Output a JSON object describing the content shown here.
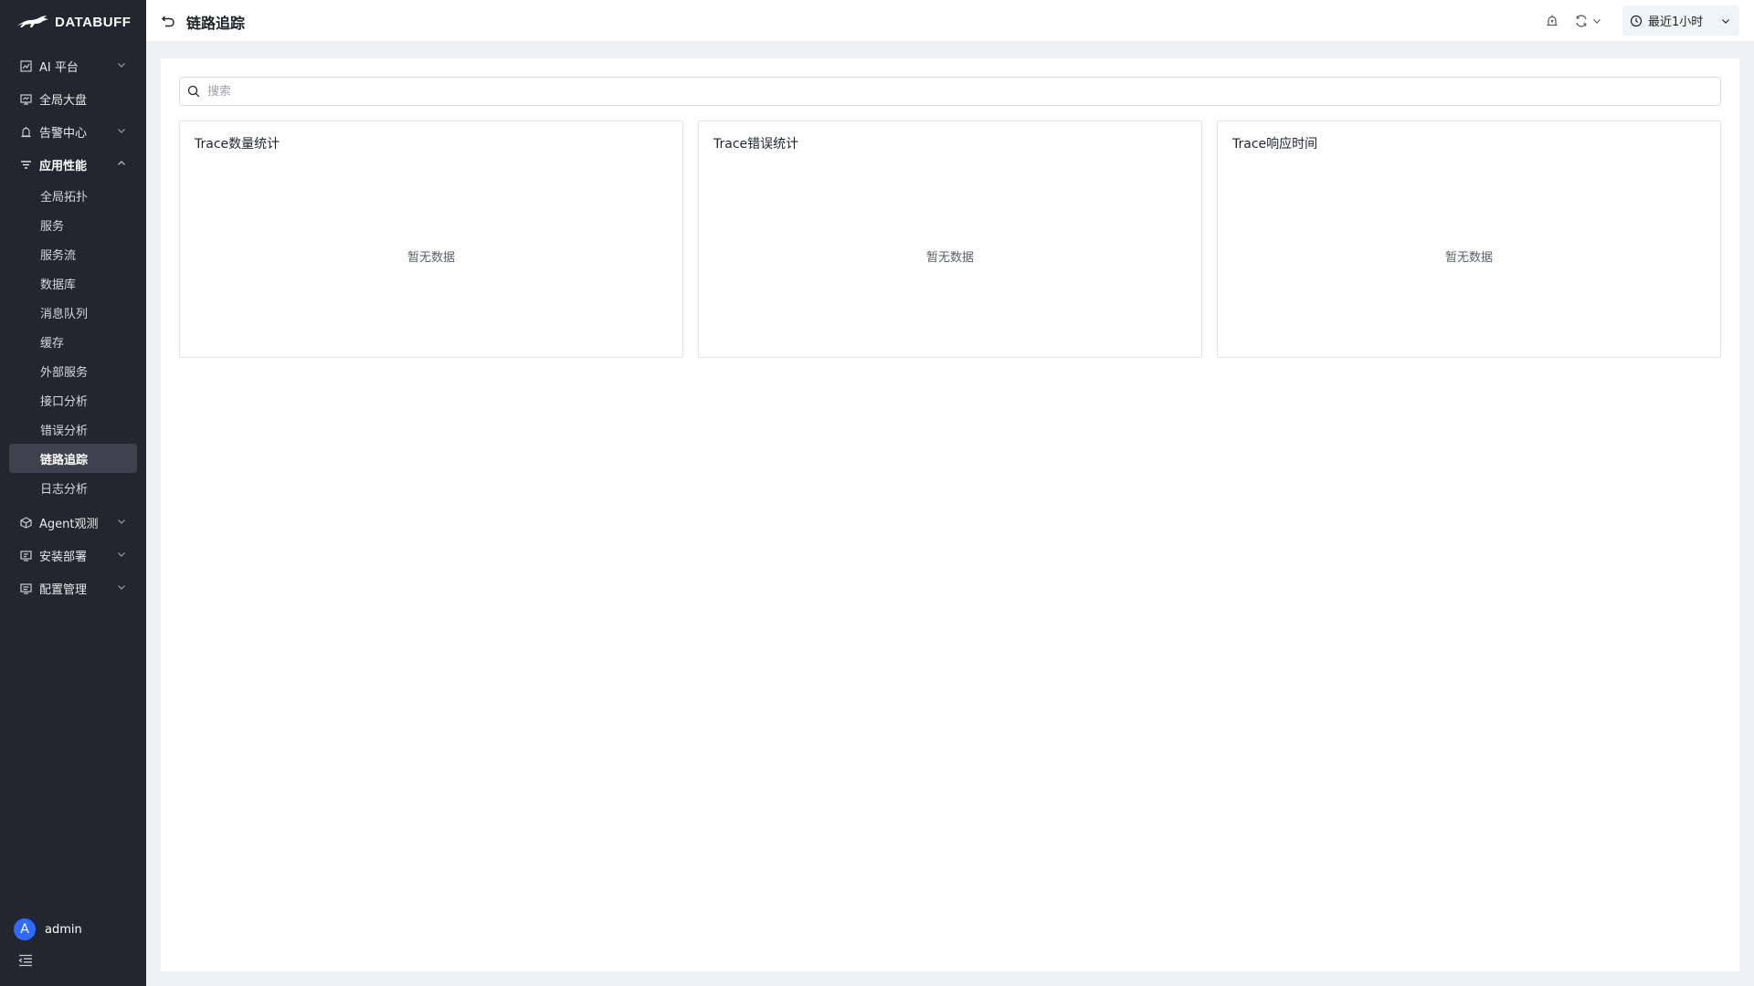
{
  "app": {
    "logo_text": "DATABUFF"
  },
  "sidebar": {
    "items": [
      {
        "label": "AI 平台",
        "icon": "chart-icon",
        "expandable": true
      },
      {
        "label": "全局大盘",
        "icon": "monitor-icon",
        "expandable": false
      },
      {
        "label": "告警中心",
        "icon": "alarm-icon",
        "expandable": true
      },
      {
        "label": "应用性能",
        "icon": "filter-list-icon",
        "expandable": true,
        "open": true,
        "children": [
          "全局拓扑",
          "服务",
          "服务流",
          "数据库",
          "消息队列",
          "缓存",
          "外部服务",
          "接口分析",
          "错误分析",
          "链路追踪",
          "日志分析"
        ],
        "active_child": "链路追踪"
      },
      {
        "label": "Agent观测",
        "icon": "cube-icon",
        "expandable": true
      },
      {
        "label": "安装部署",
        "icon": "install-icon",
        "expandable": true
      },
      {
        "label": "配置管理",
        "icon": "settings-panel-icon",
        "expandable": true
      }
    ],
    "user": {
      "avatar_letter": "A",
      "name": "admin"
    }
  },
  "header": {
    "title": "链路追踪",
    "time_range": "最近1小时"
  },
  "search": {
    "placeholder": "搜索"
  },
  "cards": [
    {
      "title": "Trace数量统计",
      "empty_text": "暂无数据"
    },
    {
      "title": "Trace错误统计",
      "empty_text": "暂无数据"
    },
    {
      "title": "Trace响应时间",
      "empty_text": "暂无数据"
    }
  ],
  "colors": {
    "sidebar_bg": "#23262f",
    "active_bg": "#3d424d",
    "accent": "#2f6bff",
    "page_bg": "#eef0f2"
  }
}
